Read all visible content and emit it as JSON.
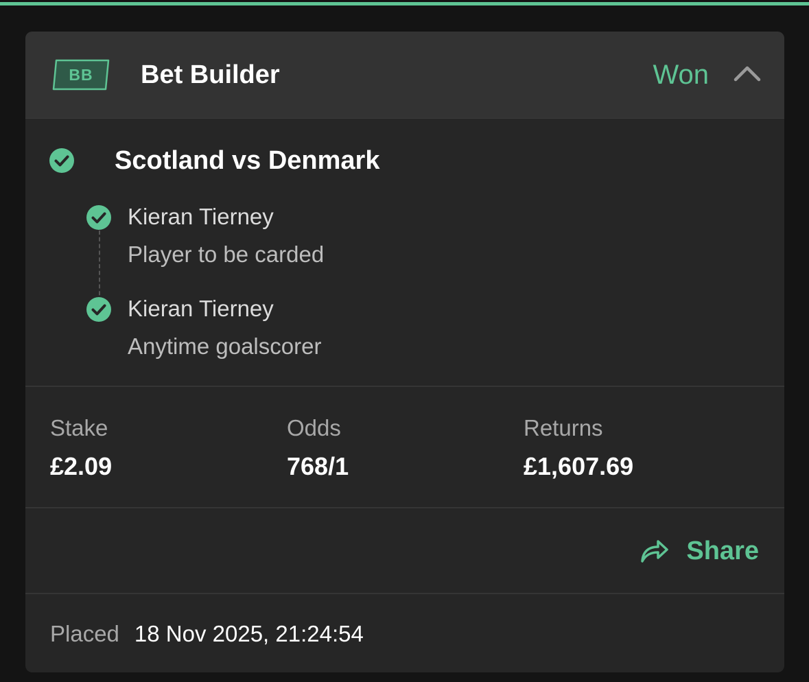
{
  "colors": {
    "accent": "#5ec494",
    "card_bg": "#262626",
    "header_bg": "#333333",
    "page_bg": "#141414"
  },
  "header": {
    "badge": "BB",
    "title": "Bet Builder",
    "status": "Won",
    "collapse_icon": "chevron-up-icon"
  },
  "event": {
    "title": "Scotland vs Denmark",
    "status_icon": "check-circle-icon"
  },
  "legs": [
    {
      "player": "Kieran Tierney",
      "market": "Player to be carded"
    },
    {
      "player": "Kieran Tierney",
      "market": "Anytime goalscorer"
    }
  ],
  "stats": {
    "stake_label": "Stake",
    "stake_value": "£2.09",
    "odds_label": "Odds",
    "odds_value": "768/1",
    "returns_label": "Returns",
    "returns_value": "£1,607.69"
  },
  "share": {
    "label": "Share",
    "icon": "share-arrow-icon"
  },
  "placed": {
    "label": "Placed",
    "value": "18 Nov 2025, 21:24:54"
  }
}
